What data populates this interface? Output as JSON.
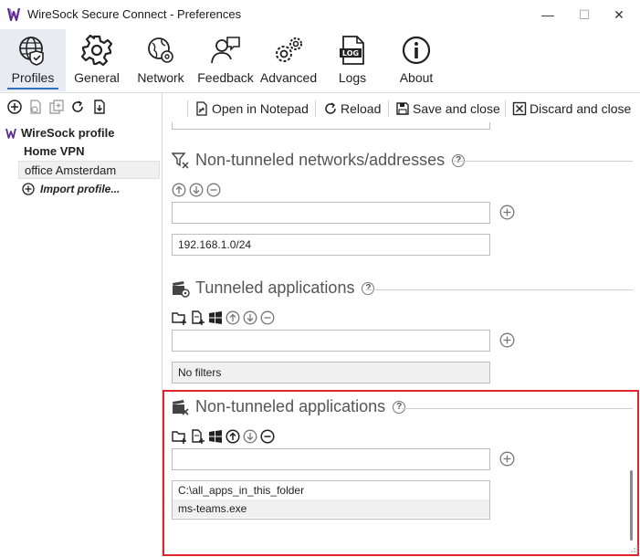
{
  "window": {
    "title": "WireSock Secure Connect - Preferences",
    "controls": {
      "minimize": "—",
      "maximize": "☐",
      "close": "✕"
    }
  },
  "toolbar": {
    "items": [
      {
        "label": "Profiles",
        "icon": "globe-shield-icon",
        "active": true
      },
      {
        "label": "General",
        "icon": "gear-icon"
      },
      {
        "label": "Network",
        "icon": "network-globe-icon"
      },
      {
        "label": "Feedback",
        "icon": "feedback-user-icon"
      },
      {
        "label": "Advanced",
        "icon": "gears-icon"
      },
      {
        "label": "Logs",
        "icon": "log-file-icon"
      },
      {
        "label": "About",
        "icon": "info-icon"
      }
    ]
  },
  "left_panel": {
    "tools": [
      "add-icon",
      "import-file-icon",
      "duplicate-icon",
      "refresh-icon",
      "export-file-icon"
    ],
    "root_label": "WireSock profile",
    "profiles": [
      {
        "label": "Home VPN",
        "bold": true
      },
      {
        "label": "office Amsterdam",
        "selected": true
      }
    ],
    "import_label": "Import profile..."
  },
  "actions": {
    "open_notepad": "Open in Notepad",
    "reload": "Reload",
    "save_close": "Save and close",
    "discard_close": "Discard and close"
  },
  "sections": {
    "non_tunneled_networks": {
      "title": "Non-tunneled networks/addresses",
      "input_value": "",
      "entries": [
        "192.168.1.0/24"
      ]
    },
    "tunneled_apps": {
      "title": "Tunneled applications",
      "input_value": "",
      "entries": [
        "No filters"
      ]
    },
    "non_tunneled_apps": {
      "title": "Non-tunneled applications",
      "input_value": "",
      "entries": [
        "C:\\all_apps_in_this_folder",
        "ms-teams.exe"
      ]
    }
  },
  "colors": {
    "highlight": "#e0262c",
    "active_tab_underline": "#2f6fbf",
    "logo_purple": "#5b2d8e"
  }
}
